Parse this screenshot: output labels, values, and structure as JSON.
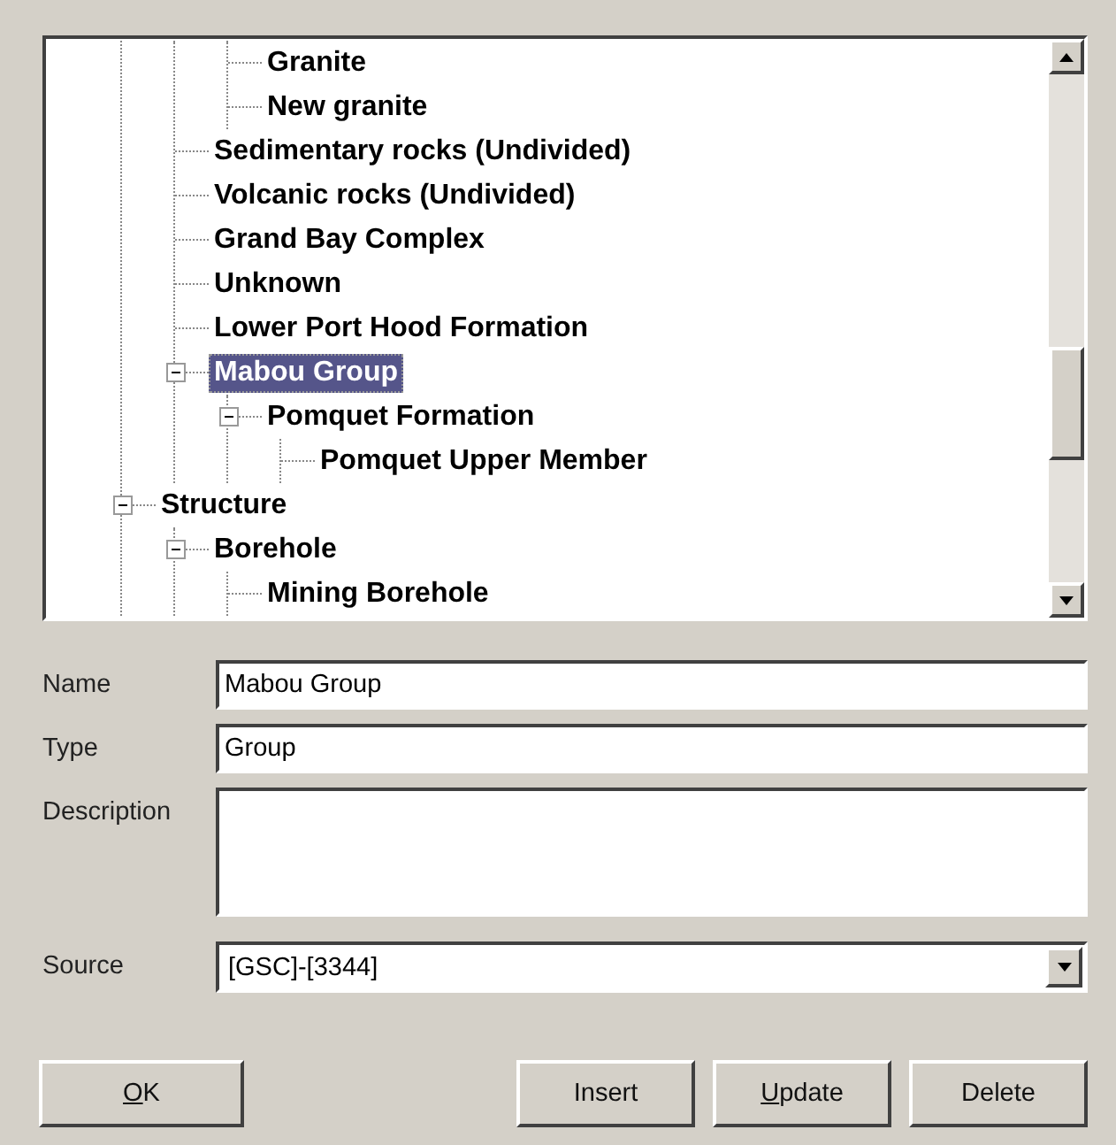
{
  "tree": {
    "items": [
      {
        "children": [
          {
            "children": [
              {
                "label": "Granite",
                "selected": false
              },
              {
                "label": "New granite",
                "selected": false
              }
            ]
          },
          {
            "label": "Sedimentary rocks (Undivided)",
            "selected": false
          },
          {
            "label": "Volcanic rocks (Undivided)",
            "selected": false
          },
          {
            "label": "Grand Bay Complex",
            "selected": false
          },
          {
            "label": "Unknown",
            "selected": false
          },
          {
            "label": "Lower Port Hood Formation",
            "selected": false
          },
          {
            "label": "Mabou Group",
            "selected": true,
            "expanded": true,
            "children": [
              {
                "label": "Pomquet Formation",
                "selected": false,
                "expanded": true,
                "children": [
                  {
                    "label": "Pomquet Upper Member",
                    "selected": false
                  }
                ]
              }
            ]
          }
        ]
      },
      {
        "label": "Structure",
        "selected": false,
        "expanded": true,
        "children": [
          {
            "label": "Borehole",
            "selected": false,
            "expanded": true,
            "children": [
              {
                "label": "Mining Borehole",
                "selected": false
              }
            ]
          }
        ]
      }
    ]
  },
  "form": {
    "fields": [
      {
        "kind": "text",
        "label": "Name",
        "value": "Mabou Group"
      },
      {
        "kind": "text",
        "label": "Type",
        "value": "Group"
      },
      {
        "kind": "textarea",
        "label": "Description"
      },
      {
        "kind": "dropdown",
        "label": "Source",
        "value": "[GSC]-[3344]"
      }
    ]
  },
  "buttons": {
    "left": [
      {
        "label": "OK",
        "mnemonic": true
      }
    ],
    "right": [
      {
        "label": "Insert",
        "mnemonic": false
      },
      {
        "label": "Update",
        "mnemonic": true
      },
      {
        "label": "Delete",
        "mnemonic": false
      }
    ]
  }
}
